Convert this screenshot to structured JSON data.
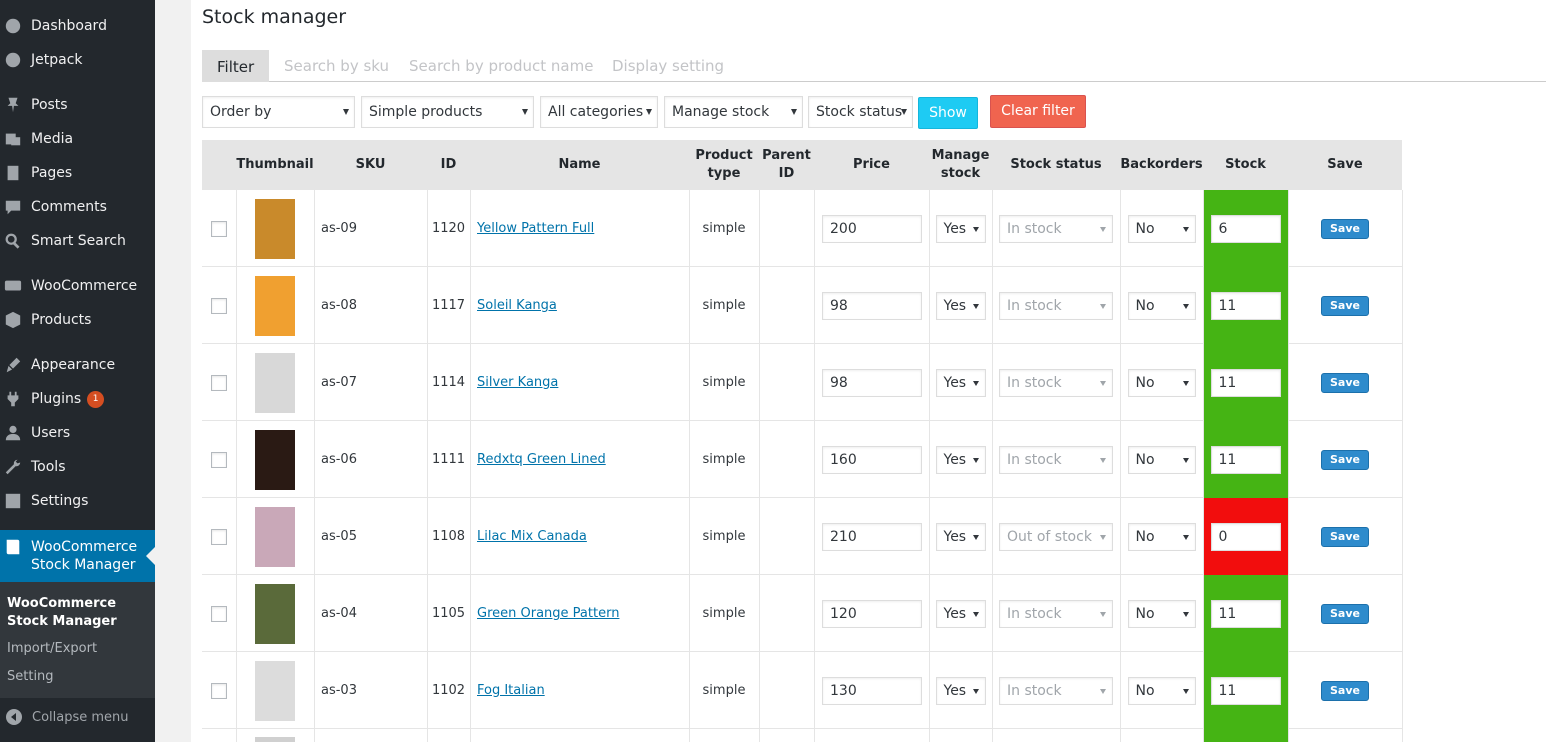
{
  "sidebar": {
    "items": [
      {
        "label": "Dashboard",
        "icon": "dashboard-icon"
      },
      {
        "label": "Jetpack",
        "icon": "jetpack-icon"
      },
      {
        "label": "Posts",
        "icon": "pushpin-icon"
      },
      {
        "label": "Media",
        "icon": "media-icon"
      },
      {
        "label": "Pages",
        "icon": "pages-icon"
      },
      {
        "label": "Comments",
        "icon": "comment-icon"
      },
      {
        "label": "Smart Search",
        "icon": "search-icon"
      },
      {
        "label": "WooCommerce",
        "icon": "woo-icon"
      },
      {
        "label": "Products",
        "icon": "box-icon"
      },
      {
        "label": "Appearance",
        "icon": "brush-icon"
      },
      {
        "label": "Plugins",
        "icon": "plug-icon",
        "badge": "1"
      },
      {
        "label": "Users",
        "icon": "user-icon"
      },
      {
        "label": "Tools",
        "icon": "wrench-icon"
      },
      {
        "label": "Settings",
        "icon": "settings-icon"
      }
    ],
    "current": {
      "label": "WooCommerce Stock Manager",
      "icon": "book-icon"
    },
    "submenu": [
      {
        "label": "WooCommerce Stock Manager"
      },
      {
        "label": "Import/Export"
      },
      {
        "label": "Setting"
      }
    ],
    "collapse": "Collapse menu"
  },
  "page": {
    "title": "Stock manager"
  },
  "tabs": [
    "Filter",
    "Search by sku",
    "Search by product name",
    "Display setting"
  ],
  "filters": {
    "order_by": "Order by",
    "product_type": "Simple products",
    "category": "All categories",
    "manage_stock": "Manage stock",
    "stock_status": "Stock status",
    "show": "Show",
    "clear": "Clear filter"
  },
  "table": {
    "headers": [
      "Thumbnail",
      "SKU",
      "ID",
      "Name",
      "Product type",
      "Parent ID",
      "Price",
      "Manage stock",
      "Stock status",
      "Backorders",
      "Stock",
      "Save"
    ],
    "rows": [
      {
        "sku": "as-09",
        "id": "1120",
        "name": "Yellow Pattern Full",
        "type": "simple",
        "price": "200",
        "manage": "Yes",
        "status": "In stock",
        "backorders": "No",
        "stock": "6",
        "stock_color": "#45b414",
        "save": "Save",
        "thumb": "#c98a2b"
      },
      {
        "sku": "as-08",
        "id": "1117",
        "name": "Soleil Kanga",
        "type": "simple",
        "price": "98",
        "manage": "Yes",
        "status": "In stock",
        "backorders": "No",
        "stock": "11",
        "stock_color": "#45b414",
        "save": "Save",
        "thumb": "#f0a030"
      },
      {
        "sku": "as-07",
        "id": "1114",
        "name": "Silver Kanga",
        "type": "simple",
        "price": "98",
        "manage": "Yes",
        "status": "In stock",
        "backorders": "No",
        "stock": "11",
        "stock_color": "#45b414",
        "save": "Save",
        "thumb": "#d8d8d8"
      },
      {
        "sku": "as-06",
        "id": "1111",
        "name": "Redxtq Green Lined",
        "type": "simple",
        "price": "160",
        "manage": "Yes",
        "status": "In stock",
        "backorders": "No",
        "stock": "11",
        "stock_color": "#45b414",
        "save": "Save",
        "thumb": "#2a1a14"
      },
      {
        "sku": "as-05",
        "id": "1108",
        "name": "Lilac Mix Canada",
        "type": "simple",
        "price": "210",
        "manage": "Yes",
        "status": "Out of stock",
        "backorders": "No",
        "stock": "0",
        "stock_color": "#f20d0d",
        "save": "Save",
        "thumb": "#c9a8b8"
      },
      {
        "sku": "as-04",
        "id": "1105",
        "name": "Green Orange Pattern",
        "type": "simple",
        "price": "120",
        "manage": "Yes",
        "status": "In stock",
        "backorders": "No",
        "stock": "11",
        "stock_color": "#45b414",
        "save": "Save",
        "thumb": "#5a6a3a"
      },
      {
        "sku": "as-03",
        "id": "1102",
        "name": "Fog Italian",
        "type": "simple",
        "price": "130",
        "manage": "Yes",
        "status": "In stock",
        "backorders": "No",
        "stock": "11",
        "stock_color": "#45b414",
        "save": "Save",
        "thumb": "#dcdcdc"
      }
    ]
  }
}
